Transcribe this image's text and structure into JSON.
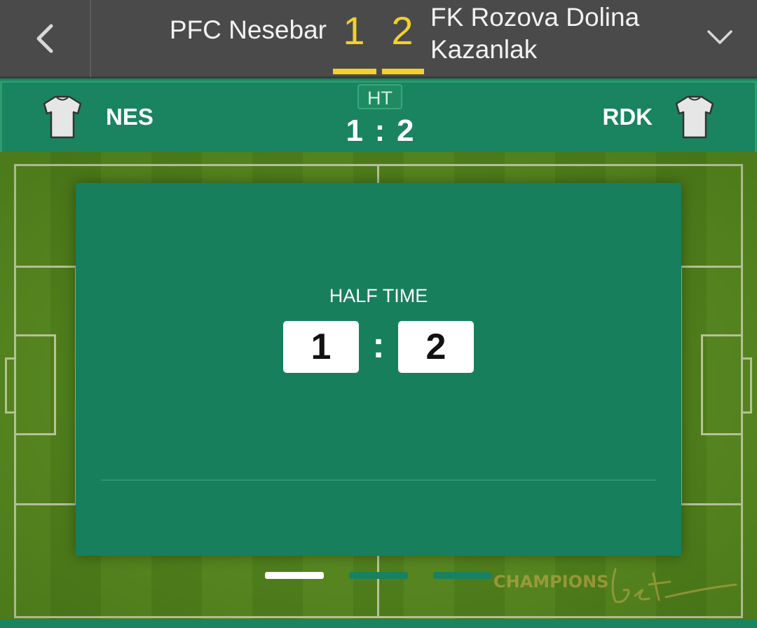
{
  "header": {
    "home_team": "PFC Nesebar",
    "away_team_line1": "FK Rozova Dolina",
    "away_team_line2": "Kazanlak",
    "home_score": "1",
    "away_score": "2"
  },
  "strip": {
    "home_abbr": "NES",
    "away_abbr": "RDK",
    "period_badge": "HT",
    "home_score": "1",
    "separator": ":",
    "away_score": "2"
  },
  "card": {
    "title": "HALF TIME",
    "home_score": "1",
    "separator": ":",
    "away_score": "2"
  },
  "pager": {
    "total": 3,
    "active": 1
  },
  "watermark": {
    "text": "CHAMPIONS",
    "script": "bet"
  },
  "colors": {
    "accent": "#f5cf2b",
    "header_bg": "#4a4a4a",
    "panel_green": "#177f5c",
    "pitch_green": "#5a8f1e"
  },
  "icons": {
    "back": "chevron-left-icon",
    "expand": "chevron-down-icon",
    "shirt": "shirt-icon"
  }
}
